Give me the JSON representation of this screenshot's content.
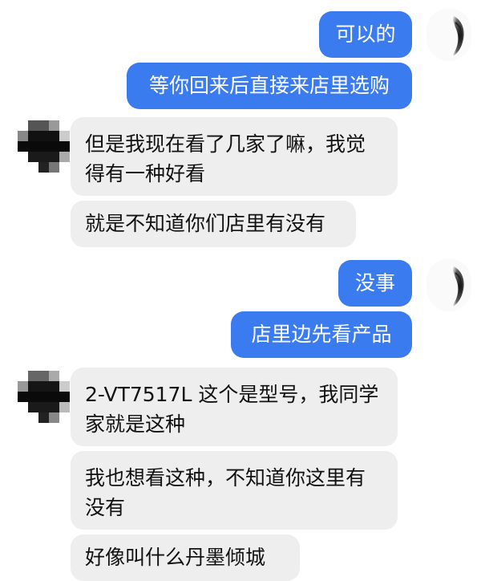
{
  "messages": [
    {
      "side": "out",
      "text": "可以的"
    },
    {
      "side": "out",
      "text": "等你回来后直接来店里选购"
    },
    {
      "side": "in",
      "text": "但是我现在看了几家了嘛，我觉\n得有一种好看"
    },
    {
      "side": "in",
      "text": "就是不知道你们店里有没有"
    },
    {
      "side": "out",
      "text": "没事"
    },
    {
      "side": "out",
      "text": "店里边先看产品"
    },
    {
      "side": "in",
      "text": "2-VT7517L 这个是型号，我同学\n家就是这种"
    },
    {
      "side": "in",
      "text": "我也想看这种，不知道你这里有\n没有"
    },
    {
      "side": "in",
      "text": "好像叫什么丹墨倾城"
    }
  ],
  "colors": {
    "outgoing_bubble": "#3a7bf0",
    "incoming_bubble": "#eeeeee",
    "background": "#ffffff"
  },
  "icons": {
    "self_avatar": "ink-wash-avatar-icon",
    "contact_avatar": "pixelated-avatar-icon"
  }
}
